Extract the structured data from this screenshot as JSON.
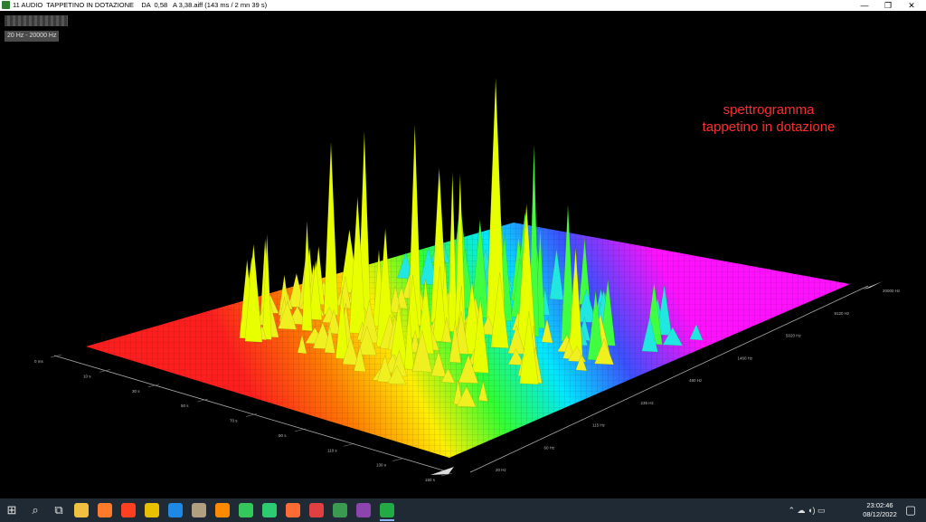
{
  "window": {
    "title": "11 AUDIO  TAPPETINO IN DOTAZIONE    DA  0,58   A 3,38.aiff (143 ms / 2 mn 39 s)",
    "min_glyph": "—",
    "max_glyph": "❐",
    "close_glyph": "✕"
  },
  "toolbar": {
    "range_label": "20 Hz - 20000 Hz"
  },
  "annotation": {
    "line1": "spettrogramma",
    "line2": "tappetino in dotazione"
  },
  "chart_data": {
    "type": "surface",
    "time_axis_ticks": [
      "0 ms",
      "10 s",
      "30 s",
      "50 s",
      "70 s",
      "90 s",
      "110 s",
      "130 s",
      "150 s"
    ],
    "freq_axis_ticks": [
      "20 Hz",
      "60 Hz",
      "115 Hz",
      "235 Hz",
      "480 Hz",
      "1460 Hz",
      "5020 Hz",
      "9120 Hz",
      "20000 Hz"
    ],
    "colormap": [
      "#ff1e1e",
      "#ff8c00",
      "#ffff00",
      "#00ff40",
      "#00ffff",
      "#3060ff",
      "#ff00ff"
    ]
  },
  "taskbar": {
    "start_glyph": "⊞",
    "search_glyph": "⌕",
    "taskview_glyph": "⧉",
    "tray_glyphs": "⌃  ☁  ◖)  ▭",
    "time": "23:02:46",
    "date": "08/12/2022",
    "notification_glyph": "▢",
    "icon_colors": [
      "#f0c040",
      "#ff7b2c",
      "#ff4020",
      "#e8c000",
      "#1e88e5",
      "#b0a080",
      "#ff8a00",
      "#34c759",
      "#2ecc71",
      "#ff6b35",
      "#e04040",
      "#3a9a50",
      "#8e44ad",
      "#22aa44"
    ]
  }
}
